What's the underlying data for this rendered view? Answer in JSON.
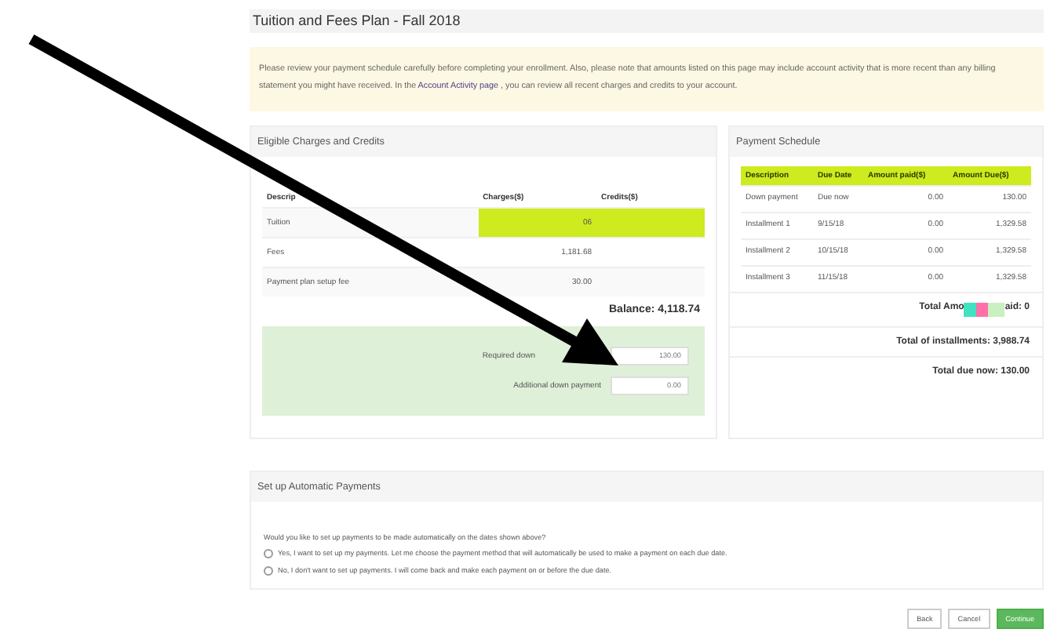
{
  "page": {
    "title": "Tuition and Fees Plan - Fall 2018"
  },
  "notice": {
    "before": "Please review your payment schedule carefully before completing your enrollment. Also, please note that amounts listed on this page may include account activity that is more recent than any billing statement you might have received. In the",
    "link": "Account Activity page",
    "after": ", you can review all recent charges and credits to your account."
  },
  "charges": {
    "title": "Eligible Charges and Credits",
    "columns": [
      "Descrip",
      "Charges($)",
      "Credits($)"
    ],
    "rows": [
      [
        "Tuition",
        "06",
        ""
      ],
      [
        "Fees",
        "1,181.68",
        ""
      ],
      [
        "Payment plan setup fee",
        "30.00",
        ""
      ]
    ],
    "balance": "Balance: 4,118.74",
    "down_payment": [
      {
        "label": "Required down",
        "value": "130.00"
      },
      {
        "label": "Additional down payment",
        "value": "0.00"
      }
    ]
  },
  "schedule": {
    "title": "Payment Schedule",
    "columns": [
      "Description",
      "Due Date",
      "Amount paid($)",
      "Amount Due($)"
    ],
    "rows": [
      [
        "Down payment",
        "Due now",
        "0.00",
        "130.00"
      ],
      [
        "Installment 1",
        "9/15/18",
        "0.00",
        "1,329.58"
      ],
      [
        "Installment 2",
        "10/15/18",
        "0.00",
        "1,329.58"
      ],
      [
        "Installment 3",
        "11/15/18",
        "0.00",
        "1,329.58"
      ]
    ],
    "totals": [
      {
        "label": "Total Amo",
        "tail": "aid: 0"
      },
      {
        "label": "Total of installments: 3,988.74"
      },
      {
        "label": "Total due now: 130.00"
      }
    ]
  },
  "auto": {
    "title": "Set up Automatic Payments",
    "question": "Would you like to set up payments to be made automatically on the dates shown above?",
    "options": [
      {
        "label": "Yes, I want to set up my payments. Let me choose the payment method that will automatically be used to make a payment on each due date.",
        "selected": false
      },
      {
        "label": "No, I don't want to set up payments. I will come back and make each payment on or before the due date.",
        "selected": false
      }
    ]
  },
  "buttons": [
    {
      "label": "Back",
      "kind": "plain"
    },
    {
      "label": "Cancel",
      "kind": "plain"
    },
    {
      "label": "Continue",
      "kind": "primary"
    }
  ]
}
